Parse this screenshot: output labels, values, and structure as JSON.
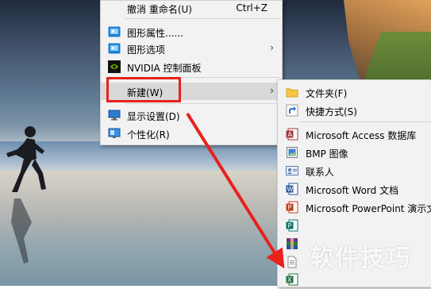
{
  "context_menu": {
    "undo_rename_label": "撤消 重命名(U)",
    "undo_shortcut": "Ctrl+Z",
    "graphics_properties_label": "图形属性......",
    "graphics_options_label": "图形选项",
    "nvidia_label": "NVIDIA 控制面板",
    "new_label": "新建(W)",
    "display_settings_label": "显示设置(D)",
    "personalize_label": "个性化(R)"
  },
  "submenu": {
    "items": [
      {
        "label": "文件夹(F)",
        "icon": "folder-icon"
      },
      {
        "label": "快捷方式(S)",
        "icon": "shortcut-icon"
      },
      {
        "label": "Microsoft Access 数据库",
        "icon": "access-icon"
      },
      {
        "label": "BMP 图像",
        "icon": "bmp-image-icon"
      },
      {
        "label": "联系人",
        "icon": "contact-icon"
      },
      {
        "label": "Microsoft Word 文档",
        "icon": "word-icon"
      },
      {
        "label": "Microsoft PowerPoint 演示文",
        "icon": "powerpoint-icon"
      },
      {
        "label": "",
        "icon": "publisher-icon"
      },
      {
        "label": "",
        "icon": "winrar-icon"
      },
      {
        "label": "",
        "icon": "text-document-icon"
      },
      {
        "label": "",
        "icon": "excel-icon"
      }
    ]
  },
  "watermark": "软件技巧",
  "colors": {
    "menu_bg": "#f2f2f2",
    "highlight": "#d9d9d9",
    "annotation_red": "#e8211d"
  }
}
